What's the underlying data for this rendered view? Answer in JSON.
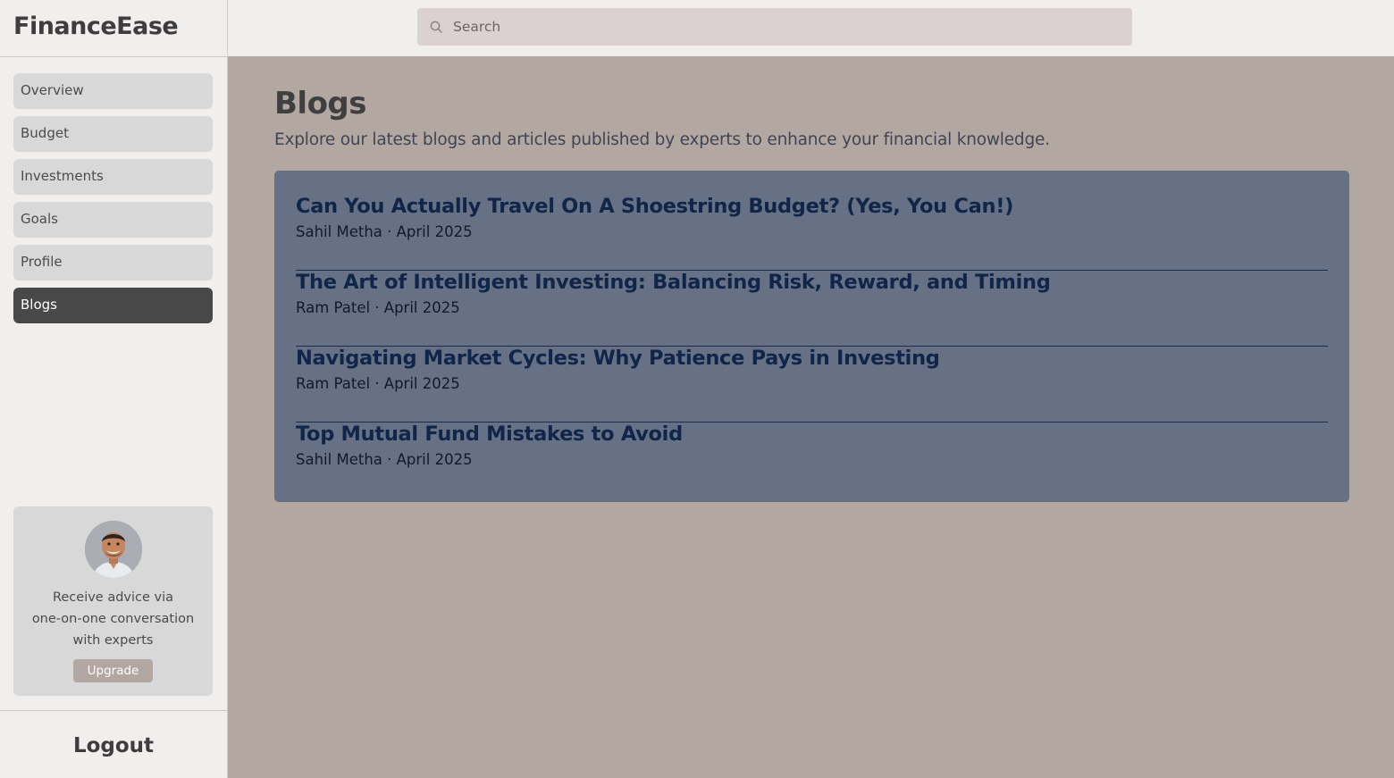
{
  "app": {
    "brand": "FinanceEase"
  },
  "search": {
    "placeholder": "Search"
  },
  "sidebar": {
    "items": [
      {
        "label": "Overview",
        "active": false
      },
      {
        "label": "Budget",
        "active": false
      },
      {
        "label": "Investments",
        "active": false
      },
      {
        "label": "Goals",
        "active": false
      },
      {
        "label": "Profile",
        "active": false
      },
      {
        "label": "Blogs",
        "active": true
      }
    ],
    "promo": {
      "line1": "Receive advice via",
      "line2": "one-on-one conversation",
      "line3": "with experts",
      "button_label": "Upgrade"
    },
    "logout_label": "Logout"
  },
  "main": {
    "title": "Blogs",
    "subtitle": "Explore our latest blogs and articles published by experts to enhance your financial knowledge.",
    "blogs": [
      {
        "title": "Can You Actually Travel On A Shoestring Budget? (Yes, You Can!)",
        "meta": "Sahil Metha · April 2025"
      },
      {
        "title": "The Art of Intelligent Investing: Balancing Risk, Reward, and Timing",
        "meta": "Ram Patel · April 2025"
      },
      {
        "title": "Navigating Market Cycles: Why Patience Pays in Investing",
        "meta": "Ram Patel · April 2025"
      },
      {
        "title": "Top Mutual Fund Mistakes to Avoid",
        "meta": "Sahil Metha · April 2025"
      }
    ]
  },
  "colors": {
    "sidebar_bg": "#f1efed",
    "main_bg": "#b3a7a2",
    "panel_bg": "#667185",
    "active_nav": "#484848",
    "blog_title": "#102548"
  }
}
